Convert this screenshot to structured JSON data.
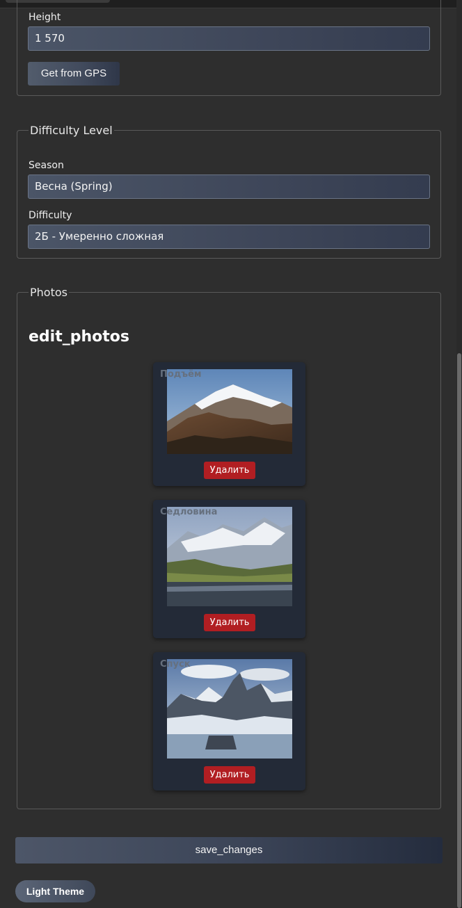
{
  "location": {
    "height_label": "Height",
    "height_value": "1 570",
    "gps_button": "Get from GPS"
  },
  "difficulty": {
    "legend": "Difficulty Level",
    "season_label": "Season",
    "season_value": "Весна (Spring)",
    "difficulty_label": "Difficulty",
    "difficulty_value": "2Б - Умеренно сложная"
  },
  "photos": {
    "legend": "Photos",
    "heading": "edit_photos",
    "items": [
      {
        "caption": "Подъём",
        "delete_label": "Удалить"
      },
      {
        "caption": "Седловина",
        "delete_label": "Удалить"
      },
      {
        "caption": "Спуск",
        "delete_label": "Удалить"
      }
    ]
  },
  "actions": {
    "save": "save_changes",
    "theme": "Light Theme"
  },
  "colors": {
    "background": "#2e2e2e",
    "delete": "#b11e22",
    "card": "#232a37"
  }
}
